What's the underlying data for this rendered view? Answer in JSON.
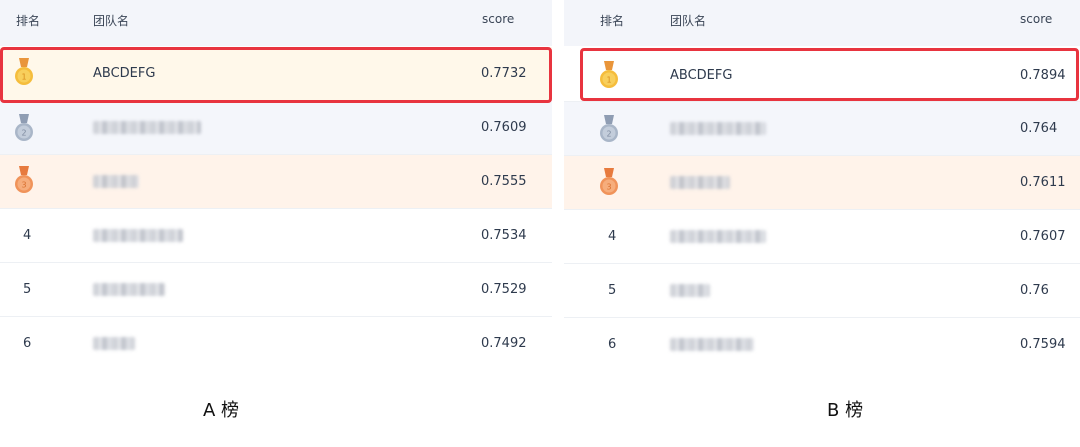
{
  "boards": [
    {
      "id": "a",
      "caption": "A 榜",
      "header": {
        "rank": "排名",
        "team": "团队名",
        "score": "score"
      },
      "rows": [
        {
          "rank": "",
          "medal": "gold-medal-icon",
          "team": "ABCDEFG",
          "team_blurred": false,
          "score": "0.7732",
          "highlighted": true
        },
        {
          "rank": "",
          "medal": "silver-medal-icon",
          "team": "",
          "team_blurred": true,
          "score": "0.7609",
          "highlighted": false
        },
        {
          "rank": "",
          "medal": "bronze-medal-icon",
          "team": "",
          "team_blurred": true,
          "score": "0.7555",
          "highlighted": false
        },
        {
          "rank": "4",
          "medal": "",
          "team": "",
          "team_blurred": true,
          "score": "0.7534",
          "highlighted": false
        },
        {
          "rank": "5",
          "medal": "",
          "team": "",
          "team_blurred": true,
          "score": "0.7529",
          "highlighted": false
        },
        {
          "rank": "6",
          "medal": "",
          "team": "",
          "team_blurred": true,
          "score": "0.7492",
          "highlighted": false
        }
      ]
    },
    {
      "id": "b",
      "caption": "B 榜",
      "header": {
        "rank": "排名",
        "team": "团队名",
        "score": "score"
      },
      "rows": [
        {
          "rank": "",
          "medal": "gold-medal-icon",
          "team": "ABCDEFG",
          "team_blurred": false,
          "score": "0.7894",
          "highlighted": true
        },
        {
          "rank": "",
          "medal": "silver-medal-icon",
          "team": "",
          "team_blurred": true,
          "score": "0.764",
          "highlighted": false
        },
        {
          "rank": "",
          "medal": "bronze-medal-icon",
          "team": "",
          "team_blurred": true,
          "score": "0.7611",
          "highlighted": false
        },
        {
          "rank": "4",
          "medal": "",
          "team": "",
          "team_blurred": true,
          "score": "0.7607",
          "highlighted": false
        },
        {
          "rank": "5",
          "medal": "",
          "team": "",
          "team_blurred": true,
          "score": "0.76",
          "highlighted": false
        },
        {
          "rank": "6",
          "medal": "",
          "team": "",
          "team_blurred": true,
          "score": "0.7594",
          "highlighted": false
        }
      ]
    }
  ],
  "colors": {
    "highlight_border": "#e8343f",
    "gold": "#f0b43a",
    "silver": "#a9b6c8",
    "bronze": "#f0935a"
  }
}
